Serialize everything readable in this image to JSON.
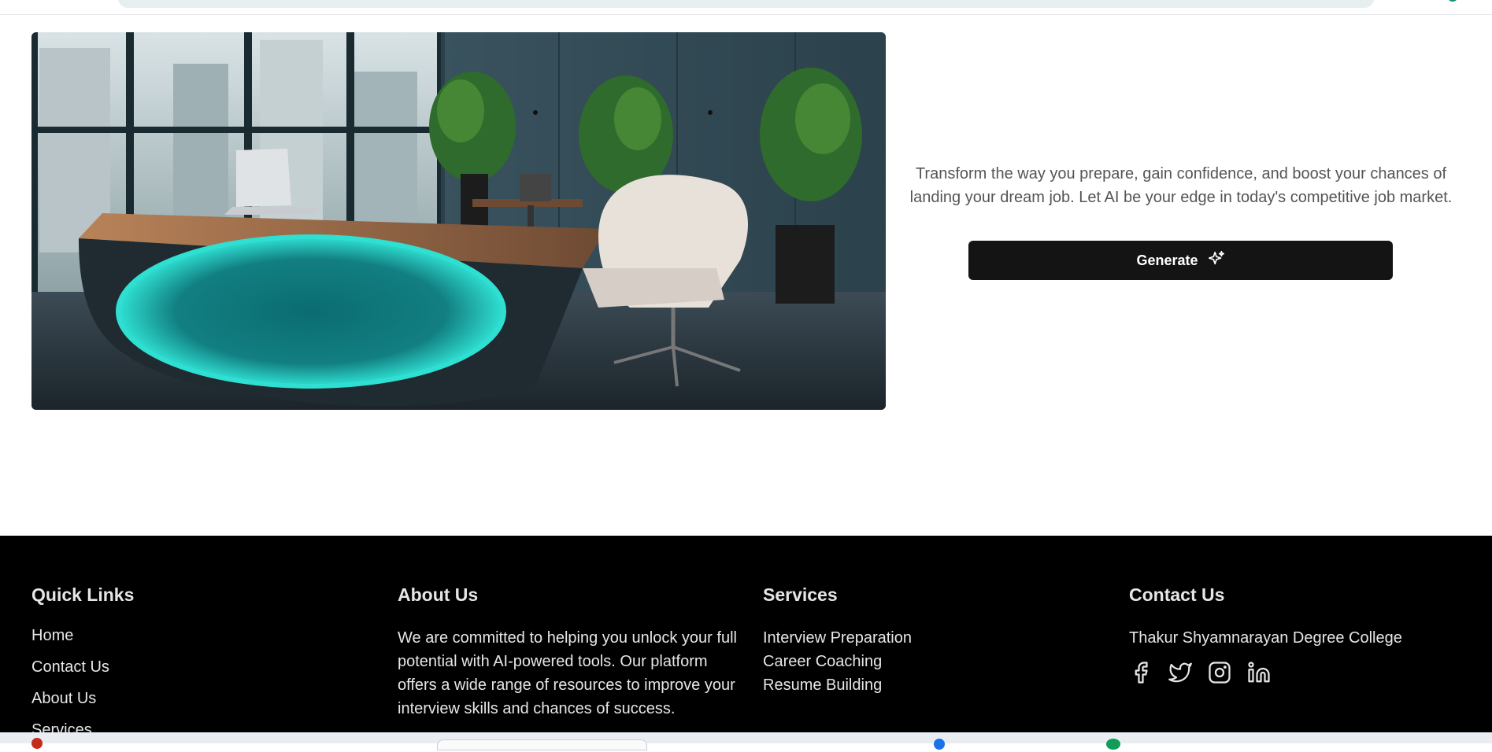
{
  "hero": {
    "description": "Transform the way you prepare, gain confidence, and boost your chances of landing your dream job. Let AI be your edge in today's competitive job market.",
    "generate_label": "Generate"
  },
  "footer": {
    "quick_links": {
      "title": "Quick Links",
      "items": [
        "Home",
        "Contact Us",
        "About Us",
        "Services"
      ]
    },
    "about": {
      "title": "About Us",
      "text": "We are committed to helping you unlock your full potential with AI-powered tools. Our platform offers a wide range of resources to improve your interview skills and chances of success."
    },
    "services": {
      "title": "Services",
      "items": [
        "Interview Preparation",
        "Career Coaching",
        "Resume Building"
      ]
    },
    "contact": {
      "title": "Contact Us",
      "address": "Thakur Shyamnarayan Degree College",
      "social_icons": [
        "facebook-icon",
        "twitter-icon",
        "instagram-icon",
        "linkedin-icon"
      ]
    }
  },
  "colors": {
    "button_bg": "#141414",
    "footer_bg": "#000000",
    "footer_text": "#e6e6e6",
    "desk_glow": "#2fe0d2"
  }
}
